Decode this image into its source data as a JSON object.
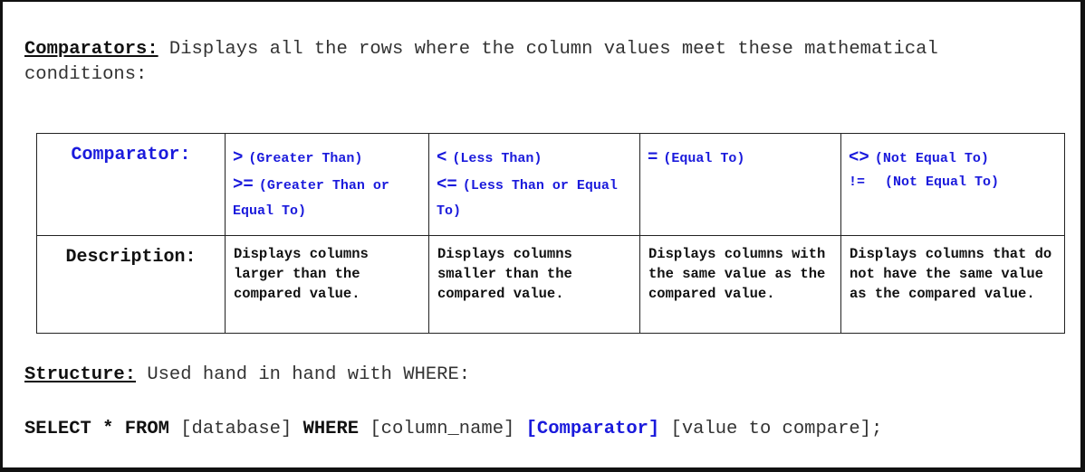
{
  "intro": {
    "label": "Comparators:",
    "text": " Displays all the rows where the column values meet these mathematical conditions:"
  },
  "table": {
    "row_headers": {
      "comparator": "Comparator:",
      "description": "Description:"
    },
    "columns": [
      {
        "operators": [
          {
            "symbol": ">",
            "name": "(Greater Than)"
          },
          {
            "symbol": ">=",
            "name": "(Greater Than or Equal To)"
          }
        ],
        "description": "Displays columns larger than the compared value."
      },
      {
        "operators": [
          {
            "symbol": "<",
            "name": "(Less Than)"
          },
          {
            "symbol": "<=",
            "name": "(Less Than or Equal To)"
          }
        ],
        "description": "Displays columns smaller than the compared value."
      },
      {
        "operators": [
          {
            "symbol": "=",
            "name": "(Equal To)"
          }
        ],
        "description": "Displays columns with the same value as the compared value."
      },
      {
        "operators": [
          {
            "symbol": "<>",
            "name": "(Not Equal To)"
          },
          {
            "symbol": "!=",
            "name": "(Not Equal To)"
          }
        ],
        "description": "Displays columns that do not have the same value as the compared value."
      }
    ]
  },
  "structure": {
    "label": "Structure:",
    "text": " Used hand in hand with WHERE:"
  },
  "sql": {
    "select": "SELECT * FROM",
    "database": " [database] ",
    "where": "WHERE",
    "column": " [column_name] ",
    "comparator": "[Comparator]",
    "value": " [value to compare];"
  },
  "colors": {
    "accent_blue": "#1a1adc",
    "text_dark": "#111111",
    "text_gray": "#333333"
  }
}
